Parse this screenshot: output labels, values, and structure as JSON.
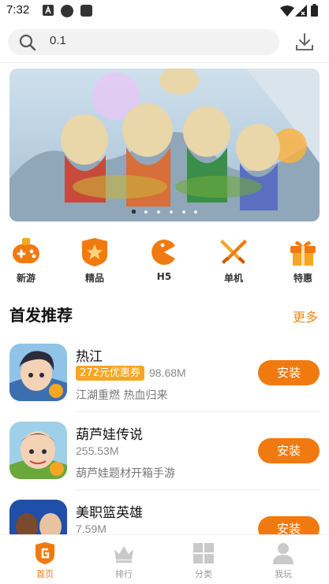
{
  "status_bar": {
    "time": "7:32"
  },
  "search": {
    "query": "0.1"
  },
  "banner": {
    "slide_count": 6,
    "active_index": 0
  },
  "categories": [
    {
      "label": "新游",
      "icon": "gamepad-icon"
    },
    {
      "label": "精品",
      "icon": "star-badge-icon"
    },
    {
      "label": "H5",
      "icon": "pacman-icon"
    },
    {
      "label": "单机",
      "icon": "crossed-swords-icon"
    },
    {
      "label": "特惠",
      "icon": "gift-icon"
    }
  ],
  "section": {
    "title": "首发推荐",
    "more": "更多"
  },
  "games": [
    {
      "name": "热江",
      "coupon": "272元优惠券",
      "size": "98.68M",
      "desc": "江湖重燃 热血归来",
      "action": "安装"
    },
    {
      "name": "葫芦娃传说",
      "coupon": "",
      "size": "255.53M",
      "desc": "葫芦娃题材开箱手游",
      "action": "安装"
    },
    {
      "name": "美职篮英雄",
      "coupon": "",
      "size": "7.59M",
      "desc": "",
      "action": "安装"
    }
  ],
  "bottom_nav": [
    {
      "label": "首页",
      "icon": "home-shield-icon",
      "active": true
    },
    {
      "label": "排行",
      "icon": "crown-icon",
      "active": false
    },
    {
      "label": "分类",
      "icon": "grid-icon",
      "active": false
    },
    {
      "label": "我玩",
      "icon": "user-icon",
      "active": false
    }
  ],
  "colors": {
    "accent": "#f07a10",
    "coupon": "#f5a623",
    "more": "#f08a18"
  }
}
